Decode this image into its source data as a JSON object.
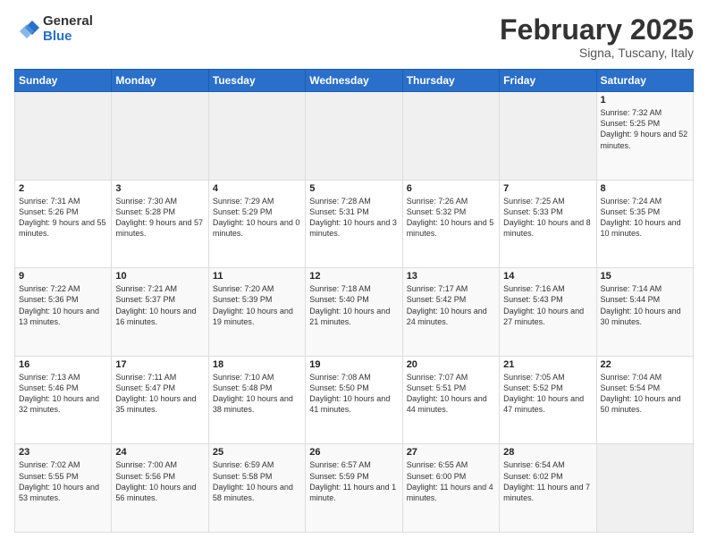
{
  "header": {
    "logo_general": "General",
    "logo_blue": "Blue",
    "title": "February 2025",
    "subtitle": "Signa, Tuscany, Italy"
  },
  "weekdays": [
    "Sunday",
    "Monday",
    "Tuesday",
    "Wednesday",
    "Thursday",
    "Friday",
    "Saturday"
  ],
  "weeks": [
    [
      {
        "day": "",
        "info": ""
      },
      {
        "day": "",
        "info": ""
      },
      {
        "day": "",
        "info": ""
      },
      {
        "day": "",
        "info": ""
      },
      {
        "day": "",
        "info": ""
      },
      {
        "day": "",
        "info": ""
      },
      {
        "day": "1",
        "info": "Sunrise: 7:32 AM\nSunset: 5:25 PM\nDaylight: 9 hours and 52 minutes."
      }
    ],
    [
      {
        "day": "2",
        "info": "Sunrise: 7:31 AM\nSunset: 5:26 PM\nDaylight: 9 hours and 55 minutes."
      },
      {
        "day": "3",
        "info": "Sunrise: 7:30 AM\nSunset: 5:28 PM\nDaylight: 9 hours and 57 minutes."
      },
      {
        "day": "4",
        "info": "Sunrise: 7:29 AM\nSunset: 5:29 PM\nDaylight: 10 hours and 0 minutes."
      },
      {
        "day": "5",
        "info": "Sunrise: 7:28 AM\nSunset: 5:31 PM\nDaylight: 10 hours and 3 minutes."
      },
      {
        "day": "6",
        "info": "Sunrise: 7:26 AM\nSunset: 5:32 PM\nDaylight: 10 hours and 5 minutes."
      },
      {
        "day": "7",
        "info": "Sunrise: 7:25 AM\nSunset: 5:33 PM\nDaylight: 10 hours and 8 minutes."
      },
      {
        "day": "8",
        "info": "Sunrise: 7:24 AM\nSunset: 5:35 PM\nDaylight: 10 hours and 10 minutes."
      }
    ],
    [
      {
        "day": "9",
        "info": "Sunrise: 7:22 AM\nSunset: 5:36 PM\nDaylight: 10 hours and 13 minutes."
      },
      {
        "day": "10",
        "info": "Sunrise: 7:21 AM\nSunset: 5:37 PM\nDaylight: 10 hours and 16 minutes."
      },
      {
        "day": "11",
        "info": "Sunrise: 7:20 AM\nSunset: 5:39 PM\nDaylight: 10 hours and 19 minutes."
      },
      {
        "day": "12",
        "info": "Sunrise: 7:18 AM\nSunset: 5:40 PM\nDaylight: 10 hours and 21 minutes."
      },
      {
        "day": "13",
        "info": "Sunrise: 7:17 AM\nSunset: 5:42 PM\nDaylight: 10 hours and 24 minutes."
      },
      {
        "day": "14",
        "info": "Sunrise: 7:16 AM\nSunset: 5:43 PM\nDaylight: 10 hours and 27 minutes."
      },
      {
        "day": "15",
        "info": "Sunrise: 7:14 AM\nSunset: 5:44 PM\nDaylight: 10 hours and 30 minutes."
      }
    ],
    [
      {
        "day": "16",
        "info": "Sunrise: 7:13 AM\nSunset: 5:46 PM\nDaylight: 10 hours and 32 minutes."
      },
      {
        "day": "17",
        "info": "Sunrise: 7:11 AM\nSunset: 5:47 PM\nDaylight: 10 hours and 35 minutes."
      },
      {
        "day": "18",
        "info": "Sunrise: 7:10 AM\nSunset: 5:48 PM\nDaylight: 10 hours and 38 minutes."
      },
      {
        "day": "19",
        "info": "Sunrise: 7:08 AM\nSunset: 5:50 PM\nDaylight: 10 hours and 41 minutes."
      },
      {
        "day": "20",
        "info": "Sunrise: 7:07 AM\nSunset: 5:51 PM\nDaylight: 10 hours and 44 minutes."
      },
      {
        "day": "21",
        "info": "Sunrise: 7:05 AM\nSunset: 5:52 PM\nDaylight: 10 hours and 47 minutes."
      },
      {
        "day": "22",
        "info": "Sunrise: 7:04 AM\nSunset: 5:54 PM\nDaylight: 10 hours and 50 minutes."
      }
    ],
    [
      {
        "day": "23",
        "info": "Sunrise: 7:02 AM\nSunset: 5:55 PM\nDaylight: 10 hours and 53 minutes."
      },
      {
        "day": "24",
        "info": "Sunrise: 7:00 AM\nSunset: 5:56 PM\nDaylight: 10 hours and 56 minutes."
      },
      {
        "day": "25",
        "info": "Sunrise: 6:59 AM\nSunset: 5:58 PM\nDaylight: 10 hours and 58 minutes."
      },
      {
        "day": "26",
        "info": "Sunrise: 6:57 AM\nSunset: 5:59 PM\nDaylight: 11 hours and 1 minute."
      },
      {
        "day": "27",
        "info": "Sunrise: 6:55 AM\nSunset: 6:00 PM\nDaylight: 11 hours and 4 minutes."
      },
      {
        "day": "28",
        "info": "Sunrise: 6:54 AM\nSunset: 6:02 PM\nDaylight: 11 hours and 7 minutes."
      },
      {
        "day": "",
        "info": ""
      }
    ]
  ]
}
